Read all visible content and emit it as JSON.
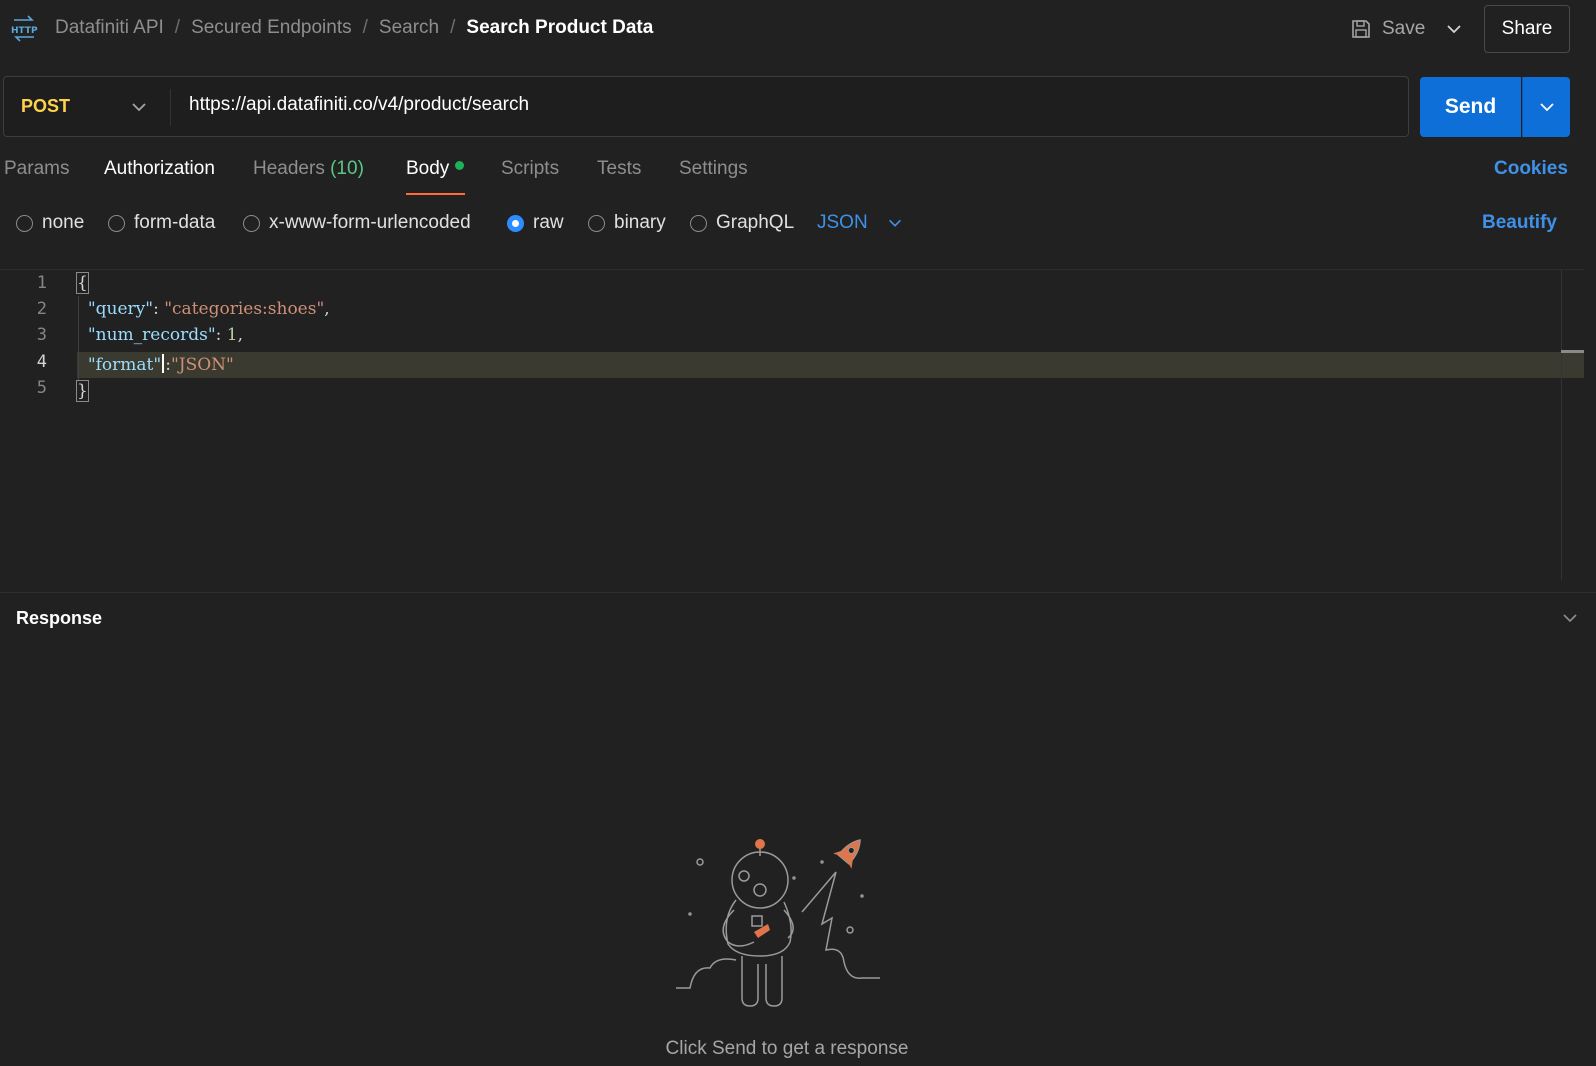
{
  "header": {
    "breadcrumb": [
      "Datafiniti API",
      "Secured Endpoints",
      "Search"
    ],
    "title": "Search Product Data",
    "save_label": "Save",
    "share_label": "Share"
  },
  "request": {
    "method": "POST",
    "url": "https://api.datafiniti.co/v4/product/search",
    "send_label": "Send"
  },
  "tabs": {
    "params": "Params",
    "authorization": "Authorization",
    "headers": "Headers",
    "headers_count": "(10)",
    "body": "Body",
    "scripts": "Scripts",
    "tests": "Tests",
    "settings": "Settings",
    "cookies": "Cookies"
  },
  "body_types": {
    "none": "none",
    "form_data": "form-data",
    "urlencoded": "x-www-form-urlencoded",
    "raw": "raw",
    "binary": "binary",
    "graphql": "GraphQL",
    "selected_format": "JSON",
    "beautify": "Beautify",
    "selected": "raw"
  },
  "editor": {
    "line_numbers": [
      "1",
      "2",
      "3",
      "4",
      "5"
    ],
    "open_brace": "{",
    "close_brace": "}",
    "query_key": "\"query\"",
    "query_value": "\"categories:shoes\"",
    "num_records_key": "\"num_records\"",
    "num_records_value": "1",
    "format_key": "\"format\"",
    "format_value": "\"JSON\""
  },
  "response": {
    "title": "Response",
    "empty_message": "Click Send to get a response"
  },
  "icons": {
    "http": "http-icon",
    "save": "floppy-disk-icon",
    "chevron": "chevron-down-icon",
    "illustration": "astronaut-rocket-illustration"
  },
  "colors": {
    "send": "#0f6fd8",
    "method": "#ffd24c",
    "link": "#3f91e8",
    "active_tab_underline": "#ff6c37",
    "body_dot": "#1fb05b"
  }
}
